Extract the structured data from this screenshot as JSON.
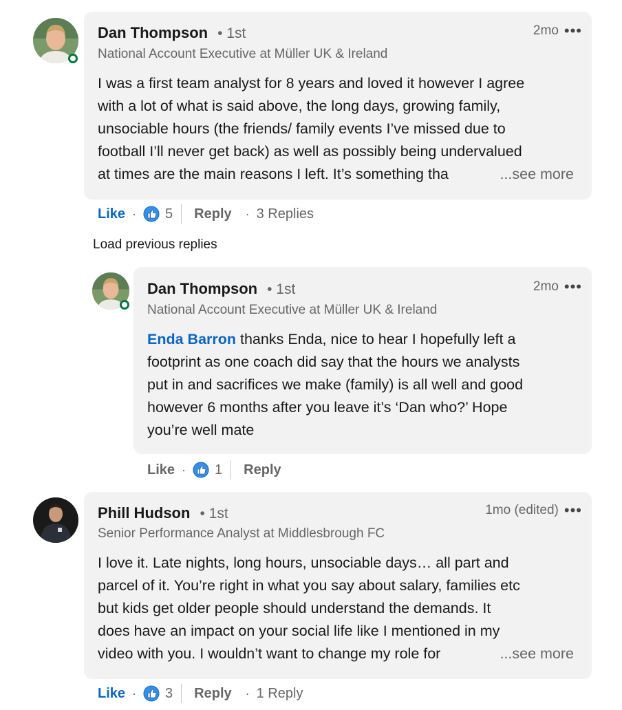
{
  "colors": {
    "link": "#0a66c2",
    "online": "#057642",
    "bubble": "#f2f2f2",
    "muted": "#666666"
  },
  "comment1": {
    "avatar_icon": "profile-photo",
    "author": "Dan Thompson",
    "degree": "• 1st",
    "headline": "National Account Executive at Müller UK & Ireland",
    "time": "2mo",
    "more_icon": "•••",
    "lines": [
      "I was a first team analyst for 8 years and loved it however I agree",
      "with a lot of what is said above, the long days, growing family,",
      "unsociable hours (the friends/ family events I’ve missed due to",
      "football I’ll never get back) as well as possibly being undervalued",
      "at times are the main reasons I left. It’s something tha"
    ],
    "see_more": "...see more",
    "like": "Like",
    "sep": "·",
    "reaction_icon": "like-reaction-icon",
    "reactions": "5",
    "reply": "Reply",
    "replies": "3 Replies"
  },
  "load_previous": "Load previous replies",
  "reply1": {
    "author": "Dan Thompson",
    "degree": "• 1st",
    "headline": "National Account Executive at Müller UK & Ireland",
    "time": "2mo",
    "more_icon": "•••",
    "mention": "Enda Barron",
    "line1_rest": " thanks Enda, nice to hear I hopefully left a",
    "lines": [
      "footprint as one coach did say that the hours we analysts",
      "put in and sacrifices we make (family) is all well and good",
      "however 6 months after you leave it’s ‘Dan who?’ Hope",
      "you’re well mate"
    ],
    "like": "Like",
    "sep": "·",
    "reactions": "1",
    "reply": "Reply"
  },
  "comment2": {
    "author": "Phill Hudson",
    "degree": "• 1st",
    "headline": "Senior Performance Analyst at Middlesbrough FC",
    "time": "1mo (edited)",
    "more_icon": "•••",
    "lines": [
      "I love it. Late nights, long hours, unsociable days… all part and",
      "parcel of it. You’re right in what you say about salary, families etc",
      "but kids get older people should understand the demands. It",
      "does have an impact on your social life like I mentioned in my",
      "video with you. I wouldn’t want to change my role for"
    ],
    "see_more": "...see more",
    "like": "Like",
    "sep": "·",
    "reactions": "3",
    "reply": "Reply",
    "replies": "1 Reply"
  }
}
